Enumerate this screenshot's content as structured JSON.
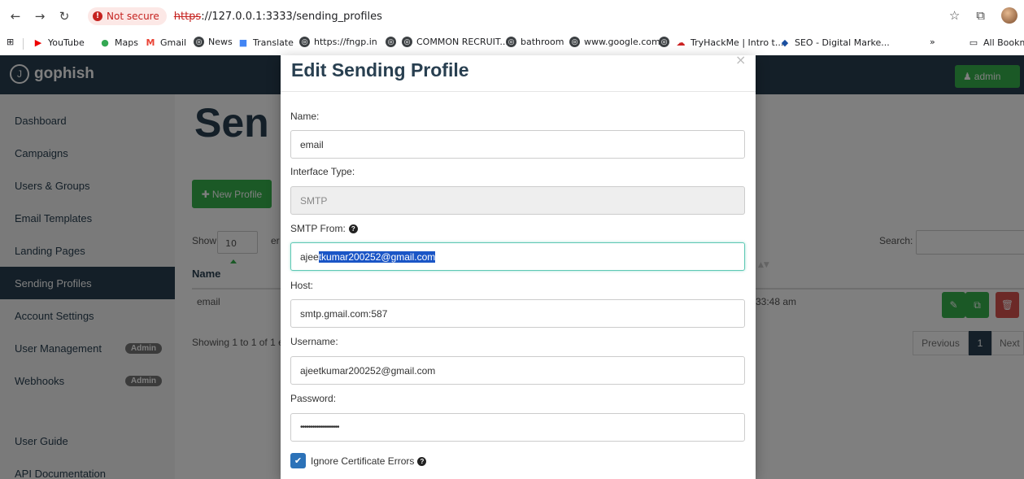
{
  "browser": {
    "security_label": "Not secure",
    "url_scheme": "https",
    "url_rest": "://127.0.0.1:3333/sending_profiles",
    "bookmarks": [
      "YouTube",
      "Maps",
      "Gmail",
      "News",
      "Translate",
      "https://fngp.in",
      "COMMON RECRUIT...",
      "bathroom",
      "www.google.com",
      "TryHackMe | Intro t...",
      "SEO - Digital Marke..."
    ],
    "all_bookmarks": "All Bookm",
    "more": "»"
  },
  "app": {
    "brand": "gophish",
    "user_button": "admin"
  },
  "sidebar": {
    "items": [
      {
        "label": "Dashboard"
      },
      {
        "label": "Campaigns"
      },
      {
        "label": "Users & Groups"
      },
      {
        "label": "Email Templates"
      },
      {
        "label": "Landing Pages"
      },
      {
        "label": "Sending Profiles"
      },
      {
        "label": "Account Settings"
      },
      {
        "label": "User Management",
        "badge": "Admin"
      },
      {
        "label": "Webhooks",
        "badge": "Admin"
      },
      {
        "label": "User Guide"
      },
      {
        "label": "API Documentation"
      }
    ],
    "active": "Sending Profiles"
  },
  "background": {
    "heading": "Sen",
    "new_profile": "New Profile",
    "show_label": "Show",
    "show_value": "10",
    "entries_fragment": "er",
    "search_label": "Search:",
    "col_name": "Name",
    "row_name": "email",
    "row_time": "33:48 am",
    "showing": "Showing 1 to 1 of 1 e",
    "previous": "Previous",
    "page": "1",
    "next": "Next"
  },
  "modal": {
    "title": "Edit Sending Profile",
    "close": "×",
    "fields": {
      "name_label": "Name:",
      "name_value": "email",
      "interface_label": "Interface Type:",
      "interface_value": "SMTP",
      "from_label": "SMTP From:",
      "from_prefix": "ajee",
      "from_selected": "tkumar200252@gmail.com",
      "host_label": "Host:",
      "host_value": "smtp.gmail.com:587",
      "username_label": "Username:",
      "username_value": "ajeetkumar200252@gmail.com",
      "password_label": "Password:",
      "password_value": "•••••••••••••••••••",
      "ignore_cert_label": "Ignore Certificate Errors"
    }
  },
  "colors": {
    "navbar": "#283f50",
    "accent_green": "#37b24d",
    "danger_red": "#d9534f"
  }
}
